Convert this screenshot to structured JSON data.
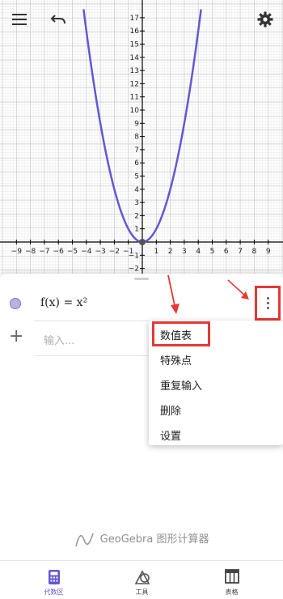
{
  "graph": {
    "y_tick_labels": [
      "17",
      "16",
      "15",
      "14",
      "13",
      "12",
      "11",
      "10",
      "9",
      "8",
      "7",
      "6",
      "5",
      "4",
      "3",
      "2",
      "1",
      "−1",
      "−2"
    ],
    "x_tick_labels": [
      "−9",
      "−8",
      "−7",
      "−6",
      "−5",
      "−4",
      "−3",
      "−2",
      "−1",
      "1",
      "2",
      "3",
      "4",
      "5",
      "6",
      "7",
      "8",
      "9"
    ],
    "curve_color": "#6557d2",
    "axis_color": "#000000"
  },
  "algebra": {
    "expression": "f(x) = x²",
    "input_placeholder": "输入..."
  },
  "context_menu": {
    "items": [
      "数值表",
      "特殊点",
      "重复输入",
      "删除",
      "设置"
    ]
  },
  "branding": "GeoGebra 图形计算器",
  "bottom_nav": {
    "tabs": [
      "代数区",
      "工具",
      "表格"
    ],
    "active_color": "#6557d2"
  },
  "annotation_color": "#e53935"
}
